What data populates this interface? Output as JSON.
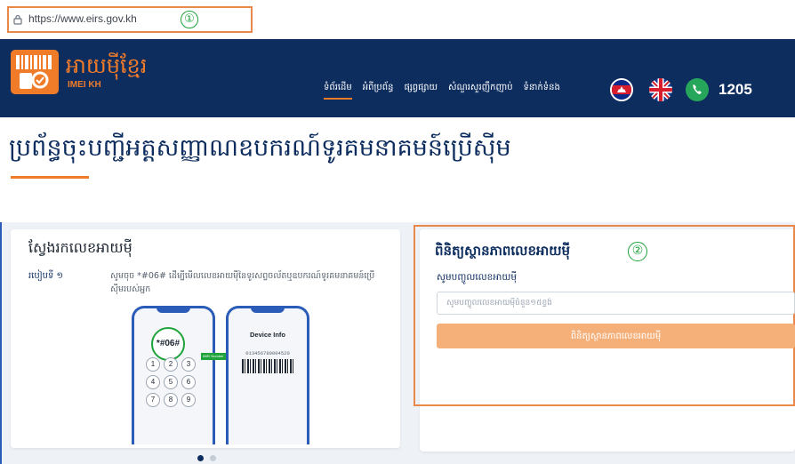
{
  "browser": {
    "url": "https://www.eirs.gov.kh",
    "annotation_1": "①"
  },
  "header": {
    "logo_title": "អាយម៉ីខ្មែរ",
    "logo_subtitle": "IMEI KH",
    "nav": [
      {
        "label": "ទំព័រដើម",
        "active": true
      },
      {
        "label": "អំពីប្រព័ន្ធ",
        "active": false
      },
      {
        "label": "ផ្សព្វផ្សាយ",
        "active": false
      },
      {
        "label": "សំណួរសួរញឹកញាប់",
        "active": false
      },
      {
        "label": "ទំនាក់ទំនង",
        "active": false
      }
    ],
    "phone_number": "1205",
    "brand_color": "#0d2d5f",
    "accent_color": "#f07c2a"
  },
  "page": {
    "title": "ប្រព័ន្ធចុះបញ្ជីអត្តសញ្ញាណឧបករណ៍ទូរគមនាគមន៍ប្រើស៊ីម"
  },
  "guide_card": {
    "title": "ស្វែងរកលេខអាយម៉ី",
    "step_label": "របៀបទី ១",
    "step_text": "សូមចុច *#06# ដើម្បីមើលលេខអាយម៉ីនៃទូរសព្ទចល័តឬឧបករណ៍ទូរគមនាគមន៍ប្រើស៊ីមរបស់អ្នក",
    "dial_code": "*#06#",
    "keys": [
      "1",
      "2",
      "3",
      "4",
      "5",
      "6",
      "7",
      "8",
      "9"
    ],
    "screen_title": "Device Info",
    "imei_sample": "013456789004520",
    "arrow_label": "IMEI Number",
    "slides_total": 2,
    "slide_active": 1
  },
  "check_card": {
    "title": "ពិនិត្យស្ថានភាពលេខអាយម៉ី",
    "annotation_2": "②",
    "field_label": "សូមបញ្ចូលលេខអាយម៉ី",
    "input_value": "",
    "input_placeholder": "សូមបញ្ចូលលេខអាយម៉ីចំនួន១៥ខ្ទង់",
    "button_label": "ពិនិត្យស្ថានភាពលេខអាយម៉ី",
    "button_color": "#f5b07a"
  }
}
